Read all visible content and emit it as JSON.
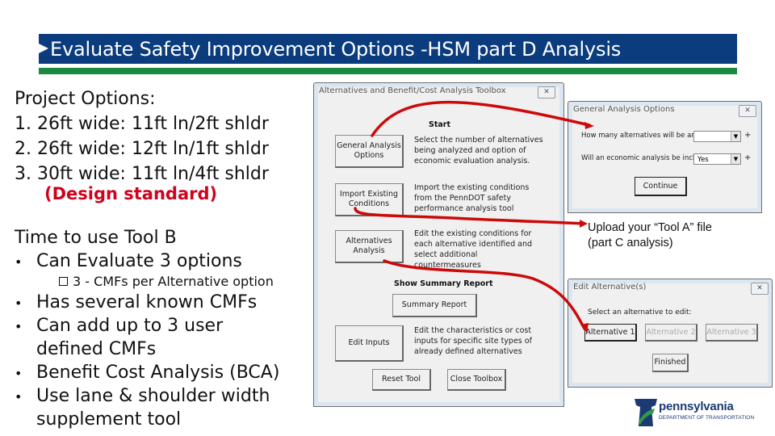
{
  "slide": {
    "title": "Evaluate Safety Improvement Options -HSM part D Analysis",
    "colors": {
      "title_bg": "#0b3c7d",
      "rule": "#1a8a3e",
      "highlight": "#d0021b",
      "arrow": "#cc0a0a"
    }
  },
  "project_options": {
    "heading": "Project Options:",
    "items": [
      "1. 26ft wide: 11ft ln/2ft shldr",
      "2. 26ft wide: 12ft ln/1ft shldr",
      "3. 30ft wide: 11ft ln/4ft shldr"
    ],
    "note": "(Design standard)"
  },
  "tool_b": {
    "heading": "Time to use Tool B",
    "bullet_char": "•",
    "bullets": [
      {
        "text": "Can Evaluate 3 options",
        "sub": "3 - CMFs per Alternative option"
      },
      {
        "text": "Has several known CMFs"
      },
      {
        "text": "Can add up to 3 user",
        "cont": "defined CMFs"
      },
      {
        "text": "Benefit Cost Analysis (BCA)"
      },
      {
        "text": "Use lane & shoulder width",
        "cont": "supplement tool"
      }
    ]
  },
  "toolbox_dialog": {
    "caption": "Alternatives and Benefit/Cost Analysis Toolbox",
    "close_glyph": "✕",
    "start_header": "Start",
    "rows": [
      {
        "button": "General Analysis Options",
        "desc": "Select the number of alternatives being analyzed and option of economic evaluation analysis."
      },
      {
        "button": "Import Existing Conditions",
        "desc": "Import the existing conditions from the PennDOT safety performance analysis tool"
      },
      {
        "button": "Alternatives Analysis",
        "desc": "Edit the existing conditions for each alternative identified and select additional countermeasures"
      }
    ],
    "summary_header": "Show Summary Report",
    "summary_button": "Summary Report",
    "edit_inputs": {
      "button": "Edit Inputs",
      "desc": "Edit the characteristics or cost inputs for specific site types of already defined alternatives"
    },
    "reset_button": "Reset Tool",
    "close_button": "Close Toolbox"
  },
  "general_options_dialog": {
    "caption": "General Analysis Options",
    "close_glyph": "✕",
    "q1": {
      "label": "How many alternatives will be analyzed?",
      "value": "",
      "plus": "+"
    },
    "q2": {
      "label": "Will an economic analysis be included?",
      "value": "Yes",
      "plus": "+"
    },
    "dropdown_glyph": "▼",
    "continue_button": "Continue"
  },
  "callout": {
    "line1": "Upload your “Tool A” file",
    "line2": "(part C analysis)"
  },
  "edit_alternatives_dialog": {
    "caption": "Edit Alternative(s)",
    "close_glyph": "✕",
    "prompt": "Select an alternative to edit:",
    "buttons": [
      "Alternative 1",
      "Alternative 2",
      "Alternative 3"
    ],
    "finished_button": "Finished"
  },
  "logo": {
    "name": "pennsylvania",
    "department": "DEPARTMENT OF TRANSPORTATION"
  }
}
